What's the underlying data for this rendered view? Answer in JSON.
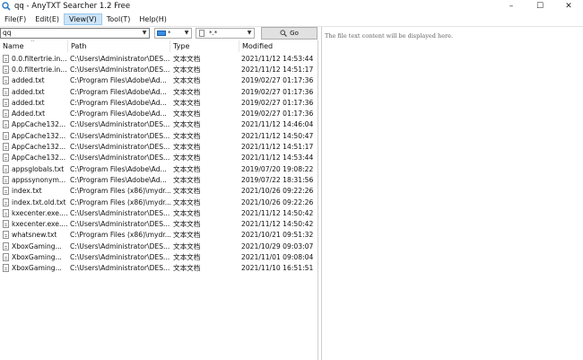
{
  "window": {
    "title": "qq - AnyTXT Searcher 1.2 Free",
    "app_icon": "magnifier-icon",
    "controls": {
      "minimize": "–",
      "maximize": "☐",
      "close": "✕"
    }
  },
  "menu": [
    {
      "label": "File(F)"
    },
    {
      "label": "Edit(E)"
    },
    {
      "label": "View(V)"
    },
    {
      "label": "Tool(T)"
    },
    {
      "label": "Help(H)"
    }
  ],
  "toolbar": {
    "search_value": "qq",
    "drive_value": "*",
    "filetype_value": "*.*",
    "go_label": "Go"
  },
  "columns": {
    "name": "Name",
    "path": "Path",
    "type": "Type",
    "modified": "Modified"
  },
  "rows": [
    {
      "name": "0.0.filtertrie.in...",
      "path": "C:\\Users\\Administrator\\DES...",
      "type": "文本文档",
      "modified": "2021/11/12  14:53:44"
    },
    {
      "name": "0.0.filtertrie.in...",
      "path": "C:\\Users\\Administrator\\DES...",
      "type": "文本文档",
      "modified": "2021/11/12  14:51:17"
    },
    {
      "name": "added.txt",
      "path": "C:\\Program Files\\Adobe\\Ad...",
      "type": "文本文档",
      "modified": "2019/02/27  01:17:36"
    },
    {
      "name": "added.txt",
      "path": "C:\\Program Files\\Adobe\\Ad...",
      "type": "文本文档",
      "modified": "2019/02/27  01:17:36"
    },
    {
      "name": "added.txt",
      "path": "C:\\Program Files\\Adobe\\Ad...",
      "type": "文本文档",
      "modified": "2019/02/27  01:17:36"
    },
    {
      "name": "Added.txt",
      "path": "C:\\Program Files\\Adobe\\Ad...",
      "type": "文本文档",
      "modified": "2019/02/27  01:17:36"
    },
    {
      "name": "AppCache132...",
      "path": "C:\\Users\\Administrator\\DES...",
      "type": "文本文档",
      "modified": "2021/11/12  14:46:04"
    },
    {
      "name": "AppCache132...",
      "path": "C:\\Users\\Administrator\\DES...",
      "type": "文本文档",
      "modified": "2021/11/12  14:50:47"
    },
    {
      "name": "AppCache132...",
      "path": "C:\\Users\\Administrator\\DES...",
      "type": "文本文档",
      "modified": "2021/11/12  14:51:17"
    },
    {
      "name": "AppCache132...",
      "path": "C:\\Users\\Administrator\\DES...",
      "type": "文本文档",
      "modified": "2021/11/12  14:53:44"
    },
    {
      "name": "appsglobals.txt",
      "path": "C:\\Program Files\\Adobe\\Ad...",
      "type": "文本文档",
      "modified": "2019/07/20  19:08:22"
    },
    {
      "name": "appssynonym...",
      "path": "C:\\Program Files\\Adobe\\Ad...",
      "type": "文本文档",
      "modified": "2019/07/22  18:31:56"
    },
    {
      "name": "index.txt",
      "path": "C:\\Program Files (x86)\\mydr...",
      "type": "文本文档",
      "modified": "2021/10/26  09:22:26"
    },
    {
      "name": "index.txt.old.txt",
      "path": "C:\\Program Files (x86)\\mydr...",
      "type": "文本文档",
      "modified": "2021/10/26  09:22:26"
    },
    {
      "name": "kxecenter.exe....",
      "path": "C:\\Users\\Administrator\\DES...",
      "type": "文本文档",
      "modified": "2021/11/12  14:50:42"
    },
    {
      "name": "kxecenter.exe....",
      "path": "C:\\Users\\Administrator\\DES...",
      "type": "文本文档",
      "modified": "2021/11/12  14:50:42"
    },
    {
      "name": "whatsnew.txt",
      "path": "C:\\Program Files (x86)\\mydr...",
      "type": "文本文档",
      "modified": "2021/10/21  09:51:32"
    },
    {
      "name": "XboxGaming...",
      "path": "C:\\Users\\Administrator\\DES...",
      "type": "文本文档",
      "modified": "2021/10/29  09:03:07"
    },
    {
      "name": "XboxGaming...",
      "path": "C:\\Users\\Administrator\\DES...",
      "type": "文本文档",
      "modified": "2021/11/01  09:08:04"
    },
    {
      "name": "XboxGaming...",
      "path": "C:\\Users\\Administrator\\DES...",
      "type": "文本文档",
      "modified": "2021/11/10  16:51:51"
    }
  ],
  "preview": {
    "placeholder": "The file text content will be displayed here."
  }
}
